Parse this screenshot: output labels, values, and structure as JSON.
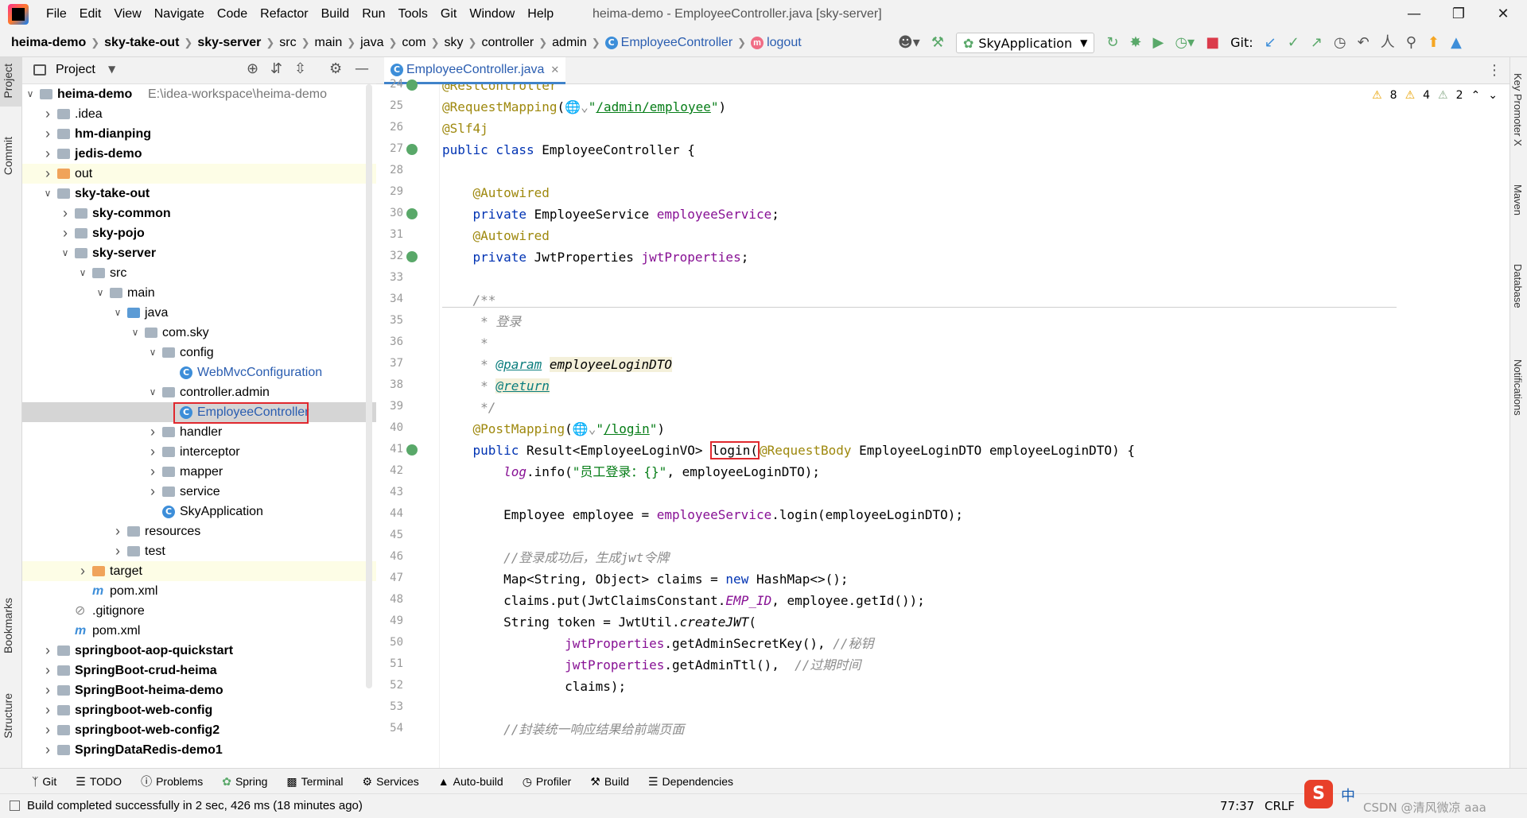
{
  "window": {
    "title": "heima-demo - EmployeeController.java [sky-server]"
  },
  "menu": [
    "File",
    "Edit",
    "View",
    "Navigate",
    "Code",
    "Refactor",
    "Build",
    "Run",
    "Tools",
    "Git",
    "Window",
    "Help"
  ],
  "breadcrumb": [
    "heima-demo",
    "sky-take-out",
    "sky-server",
    "src",
    "main",
    "java",
    "com",
    "sky",
    "controller",
    "admin",
    "EmployeeController",
    "logout"
  ],
  "run_config": "SkyApplication",
  "git_label": "Git:",
  "project_panel": {
    "title": "Project"
  },
  "tree": [
    {
      "label": "heima-demo",
      "extra": "E:\\idea-workspace\\heima-demo",
      "bold": true
    },
    {
      "label": ".idea"
    },
    {
      "label": "hm-dianping",
      "bold": true
    },
    {
      "label": "jedis-demo",
      "bold": true
    },
    {
      "label": "out"
    },
    {
      "label": "sky-take-out",
      "bold": true
    },
    {
      "label": "sky-common",
      "bold": true
    },
    {
      "label": "sky-pojo",
      "bold": true
    },
    {
      "label": "sky-server",
      "bold": true
    },
    {
      "label": "src"
    },
    {
      "label": "main"
    },
    {
      "label": "java"
    },
    {
      "label": "com.sky"
    },
    {
      "label": "config"
    },
    {
      "label": "WebMvcConfiguration"
    },
    {
      "label": "controller.admin"
    },
    {
      "label": "EmployeeController"
    },
    {
      "label": "handler"
    },
    {
      "label": "interceptor"
    },
    {
      "label": "mapper"
    },
    {
      "label": "service"
    },
    {
      "label": "SkyApplication"
    },
    {
      "label": "resources"
    },
    {
      "label": "test"
    },
    {
      "label": "target"
    },
    {
      "label": "pom.xml"
    },
    {
      "label": ".gitignore"
    },
    {
      "label": "pom.xml"
    },
    {
      "label": "springboot-aop-quickstart",
      "bold": true
    },
    {
      "label": "SpringBoot-crud-heima",
      "bold": true
    },
    {
      "label": "SpringBoot-heima-demo",
      "bold": true
    },
    {
      "label": "springboot-web-config",
      "bold": true
    },
    {
      "label": "springboot-web-config2",
      "bold": true
    },
    {
      "label": "SpringDataRedis-demo1",
      "bold": true
    }
  ],
  "editor_tab": "EmployeeController.java",
  "inspections": {
    "warnings": "8",
    "weak": "4",
    "typos": "2"
  },
  "line_numbers": [
    "24",
    "25",
    "26",
    "27",
    "28",
    "29",
    "30",
    "31",
    "32",
    "33",
    "34",
    "35",
    "36",
    "37",
    "38",
    "39",
    "40",
    "41",
    "42",
    "43",
    "44",
    "45",
    "46",
    "47",
    "48",
    "49",
    "50",
    "51",
    "52",
    "53",
    "54"
  ],
  "left_tools": [
    "Project",
    "Commit",
    "Bookmarks",
    "Structure"
  ],
  "right_tools": [
    "Key Promoter X",
    "Maven",
    "Database",
    "Notifications"
  ],
  "bottom_tools": [
    "Git",
    "TODO",
    "Problems",
    "Spring",
    "Terminal",
    "Services",
    "Auto-build",
    "Profiler",
    "Build",
    "Dependencies"
  ],
  "status": {
    "message": "Build completed successfully in 2 sec, 426 ms (18 minutes ago)",
    "position": "77:37",
    "line_sep": "CRLF",
    "watermark": "CSDN @清风微凉 aaa"
  }
}
